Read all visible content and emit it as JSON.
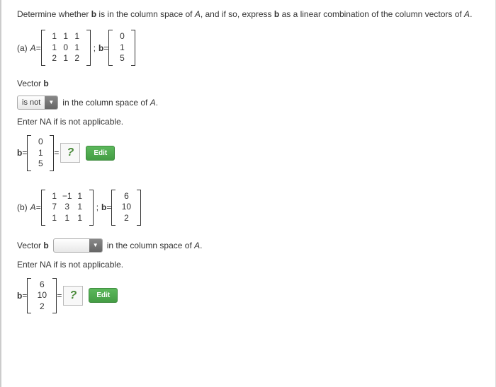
{
  "prompt": {
    "text_before_b1": "Determine whether ",
    "b1": "b",
    "text_mid1": " is in the column space of ",
    "A1": "A",
    "text_mid2": ", and if so, express ",
    "b2": "b",
    "text_mid3": " as a linear combination of the column vectors of ",
    "A2": "A",
    "period": "."
  },
  "part_a": {
    "label": "(a) ",
    "A_label": "A",
    "eq": " = ",
    "matrix_A": [
      [
        "1",
        "1",
        "1"
      ],
      [
        "1",
        "0",
        "1"
      ],
      [
        "2",
        "1",
        "2"
      ]
    ],
    "semicolon": " ; ",
    "b_label": "b",
    "eq2": " = ",
    "vector_b": [
      "0",
      "1",
      "5"
    ],
    "vector_text": "Vector ",
    "vector_b_bold": "b",
    "dropdown_value": "is not",
    "after_dropdown": " in the column space of ",
    "A_italic": "A",
    "period": ".",
    "enter_na": "Enter NA if is not applicable.",
    "expr": {
      "b": "b",
      "eq": " = ",
      "vec": [
        "0",
        "1",
        "5"
      ],
      "eq2": " = ",
      "placeholder": "?",
      "edit": "Edit"
    }
  },
  "part_b": {
    "label": "(b) ",
    "A_label": "A",
    "eq": " = ",
    "matrix_A": [
      [
        "1",
        "−1",
        "1"
      ],
      [
        "7",
        "3",
        "1"
      ],
      [
        "1",
        "1",
        "1"
      ]
    ],
    "semicolon": " ; ",
    "b_label": "b",
    "eq2": " = ",
    "vector_b": [
      "6",
      "10",
      "2"
    ],
    "vector_text": "Vector ",
    "vector_b_bold": "b",
    "dropdown_value": "",
    "after_dropdown": " in the column space of ",
    "A_italic": "A",
    "period": ".",
    "enter_na": "Enter NA if is not applicable.",
    "expr": {
      "b": "b",
      "eq": " = ",
      "vec": [
        "6",
        "10",
        "2"
      ],
      "eq2": " = ",
      "placeholder": "?",
      "edit": "Edit"
    }
  }
}
